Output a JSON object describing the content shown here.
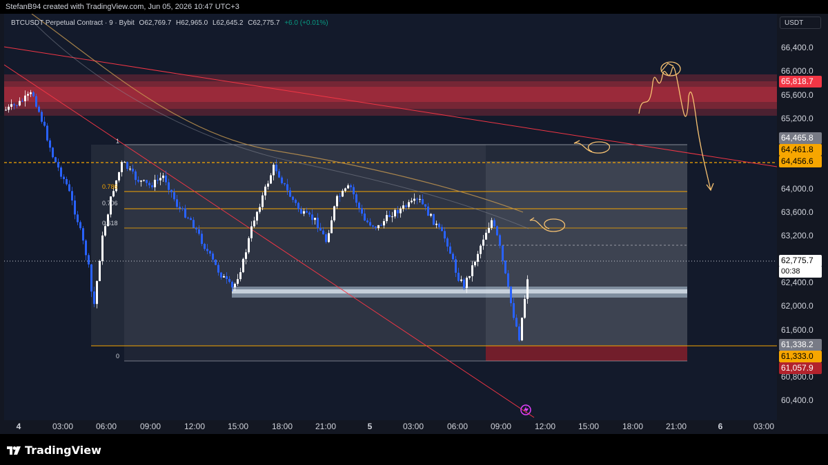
{
  "header": {
    "credit": "StefanB94 created with TradingView.com, Jun 05, 2026 10:47 UTC+3"
  },
  "symbol": {
    "title": "BTCUSDT Perpetual Contract · 9 · Bybit",
    "open": "O62,769.7",
    "high": "H62,965.0",
    "low": "L62,645.2",
    "close": "C62,775.7",
    "change": "+6.0 (+0.01%)"
  },
  "price_axis": {
    "currency": "USDT",
    "ticks": [
      "66,400.0",
      "66,000.0",
      "65,600.0",
      "65,200.0",
      "64,000.0",
      "63,600.0",
      "63,200.0",
      "62,400.0",
      "62,000.0",
      "61,600.0",
      "60,800.0",
      "60,400.0"
    ],
    "tags": [
      {
        "label": "65,818.7",
        "color": "#f23645",
        "text_color": "#ffffff"
      },
      {
        "label": "64,465.8",
        "color": "#787b86",
        "text_color": "#ffffff"
      },
      {
        "label": "64,461.8",
        "color": "#f7a600",
        "text_color": "#000000"
      },
      {
        "label": "64,456.6",
        "color": "#f7a600",
        "text_color": "#000000"
      },
      {
        "label": "62,775.7",
        "color": "#ffffff",
        "text_color": "#000000"
      },
      {
        "label": "00:38",
        "color": "#ffffff",
        "text_color": "#000000"
      },
      {
        "label": "61,338.2",
        "color": "#787b86",
        "text_color": "#ffffff"
      },
      {
        "label": "61,333.0",
        "color": "#f7a600",
        "text_color": "#000000"
      },
      {
        "label": "61,057.9",
        "color": "#b2222c",
        "text_color": "#ffffff"
      }
    ]
  },
  "time_axis": {
    "labels": [
      {
        "text": "4",
        "bold": true
      },
      {
        "text": "03:00",
        "bold": false
      },
      {
        "text": "06:00",
        "bold": false
      },
      {
        "text": "09:00",
        "bold": false
      },
      {
        "text": "12:00",
        "bold": false
      },
      {
        "text": "15:00",
        "bold": false
      },
      {
        "text": "18:00",
        "bold": false
      },
      {
        "text": "21:00",
        "bold": false
      },
      {
        "text": "5",
        "bold": true
      },
      {
        "text": "03:00",
        "bold": false
      },
      {
        "text": "06:00",
        "bold": false
      },
      {
        "text": "09:00",
        "bold": false
      },
      {
        "text": "12:00",
        "bold": false
      },
      {
        "text": "15:00",
        "bold": false
      },
      {
        "text": "18:00",
        "bold": false
      },
      {
        "text": "21:00",
        "bold": false
      },
      {
        "text": "6",
        "bold": true
      },
      {
        "text": "03:00",
        "bold": false
      }
    ]
  },
  "fib_levels": [
    {
      "label": "1"
    },
    {
      "label": "0.786"
    },
    {
      "label": "0.706"
    },
    {
      "label": "0.618"
    },
    {
      "label": "0"
    }
  ],
  "footer": {
    "brand": "TradingView"
  },
  "colors": {
    "bull": "#ffffff",
    "bear": "#2962ff",
    "resistance_zone": "#f23645",
    "fib_line": "#f7a600",
    "trendline": "#f23645"
  }
}
